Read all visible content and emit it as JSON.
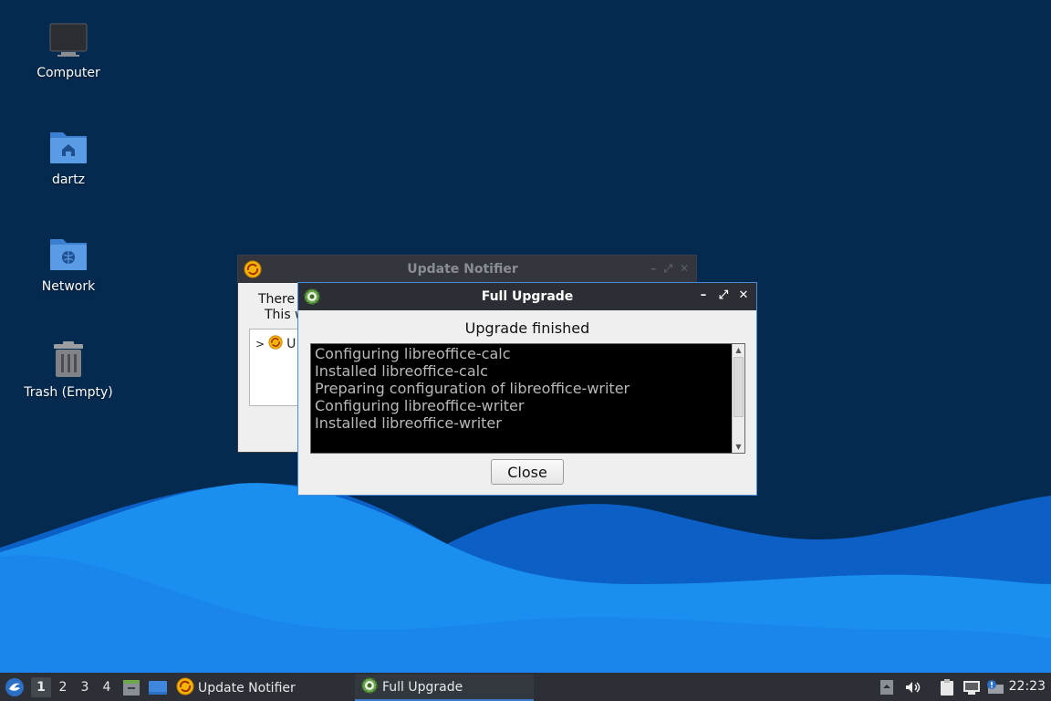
{
  "desktop": {
    "icons": [
      {
        "label": "Computer",
        "icon": "computer-icon"
      },
      {
        "label": "dartz",
        "icon": "home-folder-icon"
      },
      {
        "label": "Network",
        "icon": "network-folder-icon"
      },
      {
        "label": "Trash (Empty)",
        "icon": "trash-icon"
      }
    ]
  },
  "notifier_window": {
    "title": "Update Notifier",
    "message_line1": "There",
    "message_line2": "This w",
    "tree_item": "U"
  },
  "upgrade_dialog": {
    "title": "Full Upgrade",
    "heading": "Upgrade finished",
    "log_lines": [
      "Configuring libreoffice-calc",
      "Installed libreoffice-calc",
      "Preparing configuration of libreoffice-writer",
      "Configuring libreoffice-writer",
      "Installed libreoffice-writer"
    ],
    "close_label": "Close",
    "controls": {
      "minimize": "–",
      "maximize": "⤢",
      "close": "✕"
    }
  },
  "taskbar": {
    "workspaces": [
      "1",
      "2",
      "3",
      "4"
    ],
    "active_workspace": "1",
    "tasks": [
      {
        "label": "Update Notifier",
        "icon": "update-notifier-icon",
        "active": false
      },
      {
        "label": "Full Upgrade",
        "icon": "gear-icon",
        "active": true
      }
    ],
    "clock": "22:23"
  },
  "colors": {
    "desktop_bg": "#042a50",
    "wave_light": "#1a8ff0",
    "wave_dark": "#0b5fc5",
    "accent": "#3d7bd1"
  }
}
